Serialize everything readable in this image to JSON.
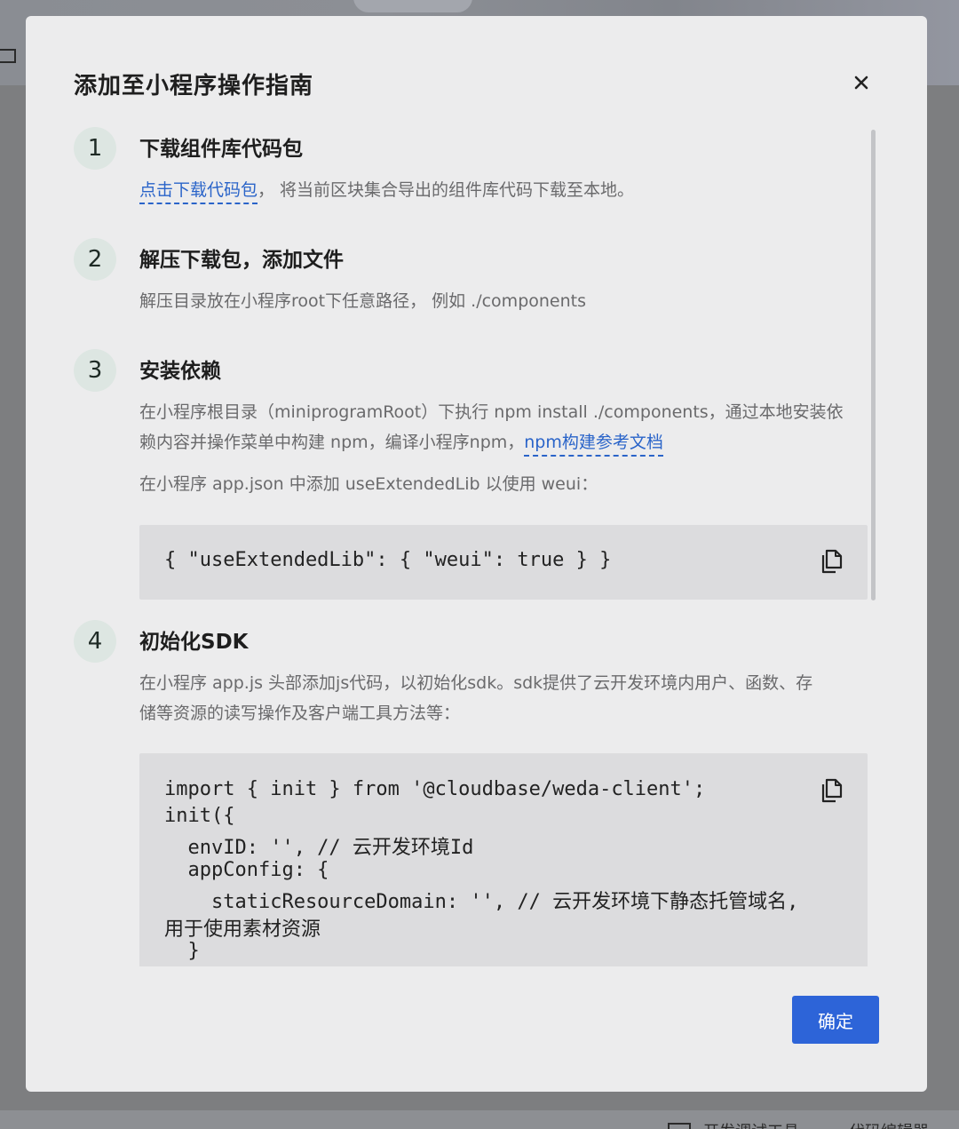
{
  "modal": {
    "title": "添加至小程序操作指南",
    "confirm_label": "确定"
  },
  "background": {
    "bottom_item_1": "开发调试工具",
    "bottom_item_2": "代码编辑器"
  },
  "steps": [
    {
      "number": "1",
      "title": "下载组件库代码包",
      "link": "点击下载代码包",
      "text": "， 将当前区块集合导出的组件库代码下载至本地。"
    },
    {
      "number": "2",
      "title": "解压下载包，添加文件",
      "text": "解压目录放在小程序root下任意路径， 例如 ./components"
    },
    {
      "number": "3",
      "title": "安装依赖",
      "text_line1": "在小程序根目录（miniprogramRoot）下执行 npm install ./components，通过本地安装依",
      "text_line2": "赖内容并操作菜单中构建 npm，编译小程序npm，",
      "link": "npm构建参考文档",
      "text_line3": "在小程序 app.json 中添加 useExtendedLib 以使用 weui：",
      "code": "{ \"useExtendedLib\": { \"weui\": true } }"
    },
    {
      "number": "4",
      "title": "初始化SDK",
      "text_line1": "在小程序 app.js 头部添加js代码，以初始化sdk。sdk提供了云开发环境内用户、函数、存",
      "text_line2": "储等资源的读写操作及客户端工具方法等：",
      "code_lines": [
        "import { init } from '@cloudbase/weda-client';",
        "init({",
        "  envID: '', // 云开发环境Id",
        "  appConfig: {",
        "    staticResourceDomain: '', // 云开发环境下静态托管域名,",
        "用于使用素材资源",
        "  }",
        "})"
      ]
    }
  ],
  "icons": {
    "close": "close-icon",
    "copy": "copy-icon"
  }
}
